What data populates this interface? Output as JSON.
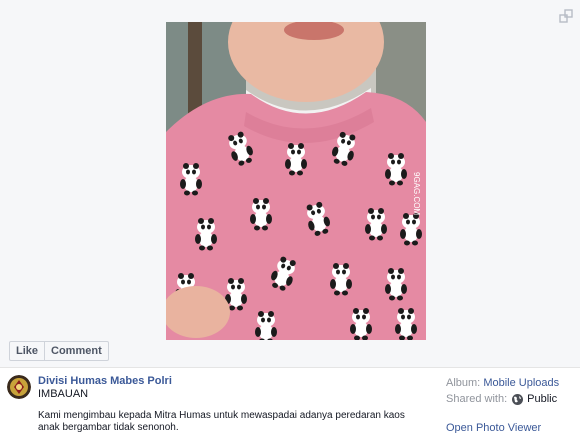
{
  "photo": {
    "alt": "Child wearing pink panda print sweater",
    "watermark": "9GAG.COM"
  },
  "actions": {
    "like_label": "Like",
    "comment_label": "Comment"
  },
  "post": {
    "page_name": "Divisi Humas Mabes Polri",
    "title": "IMBAUAN",
    "caption": "Kami mengimbau kepada Mitra Humas untuk mewaspadai adanya peredaran kaos anak bergambar tidak senonoh."
  },
  "meta": {
    "album_label": "Album:",
    "album_value": "Mobile Uploads",
    "shared_label": "Shared with:",
    "shared_value": "Public",
    "open_viewer": "Open Photo Viewer"
  },
  "icons": {
    "expand": "expand-icon",
    "globe": "globe-icon"
  },
  "colors": {
    "link": "#3b5998",
    "muted": "#90949c",
    "sweater": "#e58aa3"
  }
}
